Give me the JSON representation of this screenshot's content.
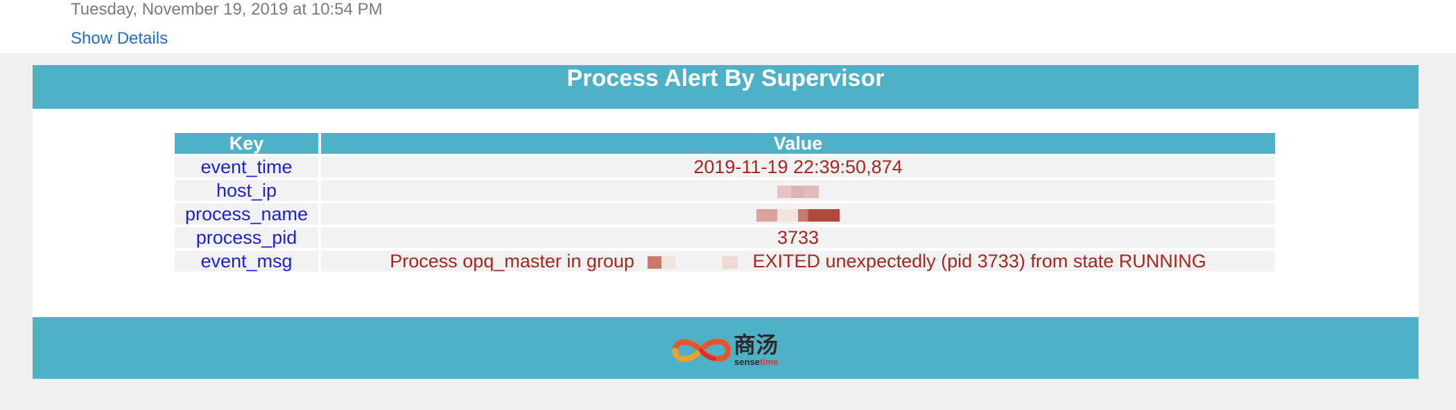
{
  "mail": {
    "date": "Tuesday, November 19, 2019 at 10:54 PM",
    "show_details": "Show Details"
  },
  "alert": {
    "title": "Process Alert By Supervisor",
    "table": {
      "headers": {
        "key": "Key",
        "value": "Value"
      },
      "rows": [
        {
          "key": "event_time",
          "value": "2019-11-19 22:39:50,874"
        },
        {
          "key": "host_ip",
          "value": ""
        },
        {
          "key": "process_name",
          "value": ""
        },
        {
          "key": "process_pid",
          "value": "3733"
        },
        {
          "key": "event_msg",
          "value_prefix": "Process opq_master in group",
          "value_suffix": "EXITED unexpectedly (pid 3733) from state RUNNING"
        }
      ]
    }
  },
  "footer": {
    "logo_cn": "商汤",
    "logo_en_a": "sense",
    "logo_en_b": "time"
  },
  "colors": {
    "accent": "#4fb1c6",
    "key_text": "#1b22d6",
    "value_text": "#a5271e",
    "link": "#1f6fc5"
  }
}
